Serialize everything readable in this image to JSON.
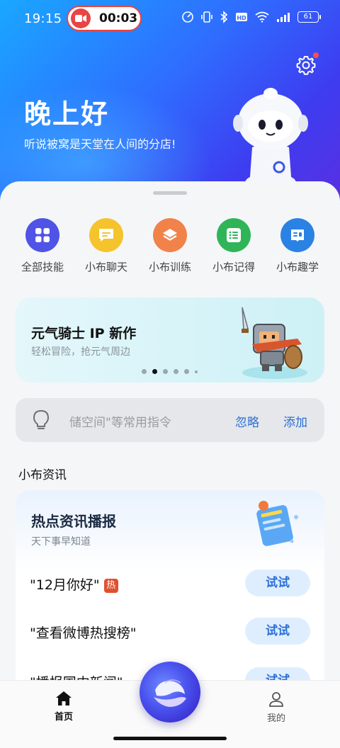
{
  "status_bar": {
    "time": "19:15",
    "recording_time": "00:03",
    "battery": "61"
  },
  "header": {
    "greeting": "晚上好",
    "subtitle": "听说被窝是天堂在人间的分店!"
  },
  "skills": [
    {
      "label": "全部技能",
      "icon": "grid-icon",
      "color": "#4f54e6"
    },
    {
      "label": "小布聊天",
      "icon": "chat-icon",
      "color": "#f5c32c"
    },
    {
      "label": "小布训练",
      "icon": "layers-icon",
      "color": "#f0824a"
    },
    {
      "label": "小布记得",
      "icon": "list-icon",
      "color": "#2fb558"
    },
    {
      "label": "小布趣学",
      "icon": "book-icon",
      "color": "#2a82e4"
    }
  ],
  "banner": {
    "title": "元气骑士 IP 新作",
    "subtitle": "轻松冒险，抢元气周边",
    "active_page": 2,
    "page_count": 6
  },
  "suggestion": {
    "text": "储空间\"等常用指令",
    "ignore": "忽略",
    "add": "添加"
  },
  "section_title": "小布资讯",
  "news": {
    "title": "热点资讯播报",
    "subtitle": "天下事早知道",
    "items": [
      {
        "query": "\"12月你好\"",
        "hot": "热",
        "action": "试试"
      },
      {
        "query": "\"查看微博热搜榜\"",
        "action": "试试"
      },
      {
        "query": "\"播报国内新闻\"",
        "action": "试试"
      }
    ]
  },
  "nav": {
    "home": "首页",
    "mine": "我的"
  },
  "colors": {
    "accent": "#2b6fd6",
    "hot": "#e0502f"
  }
}
